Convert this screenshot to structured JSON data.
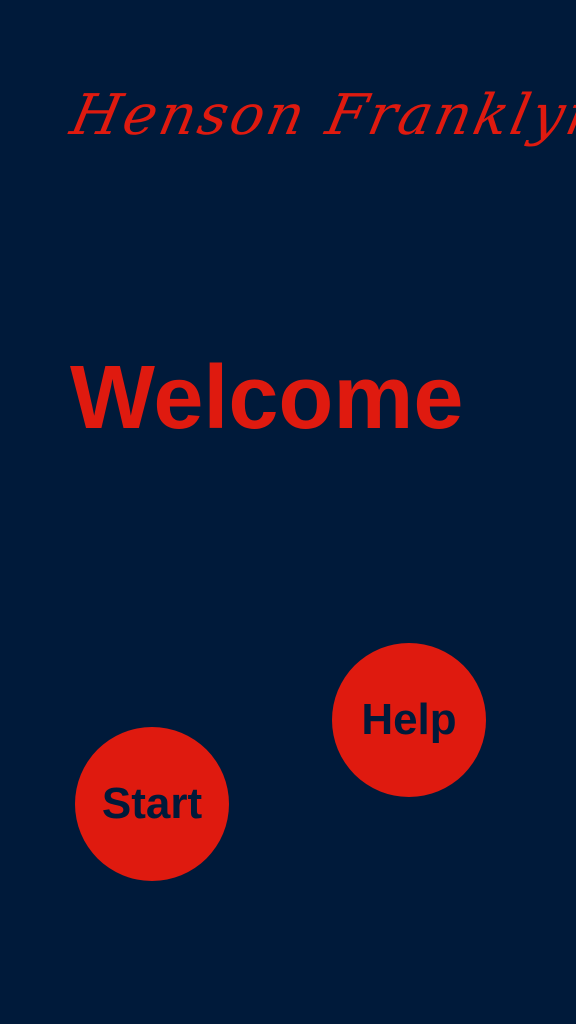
{
  "header": {
    "brand_name": "Henson Franklyn"
  },
  "main": {
    "welcome_text": "Welcome"
  },
  "buttons": {
    "help_label": "Help",
    "start_label": "Start"
  },
  "colors": {
    "background": "#001a3a",
    "accent": "#df1a0f"
  }
}
